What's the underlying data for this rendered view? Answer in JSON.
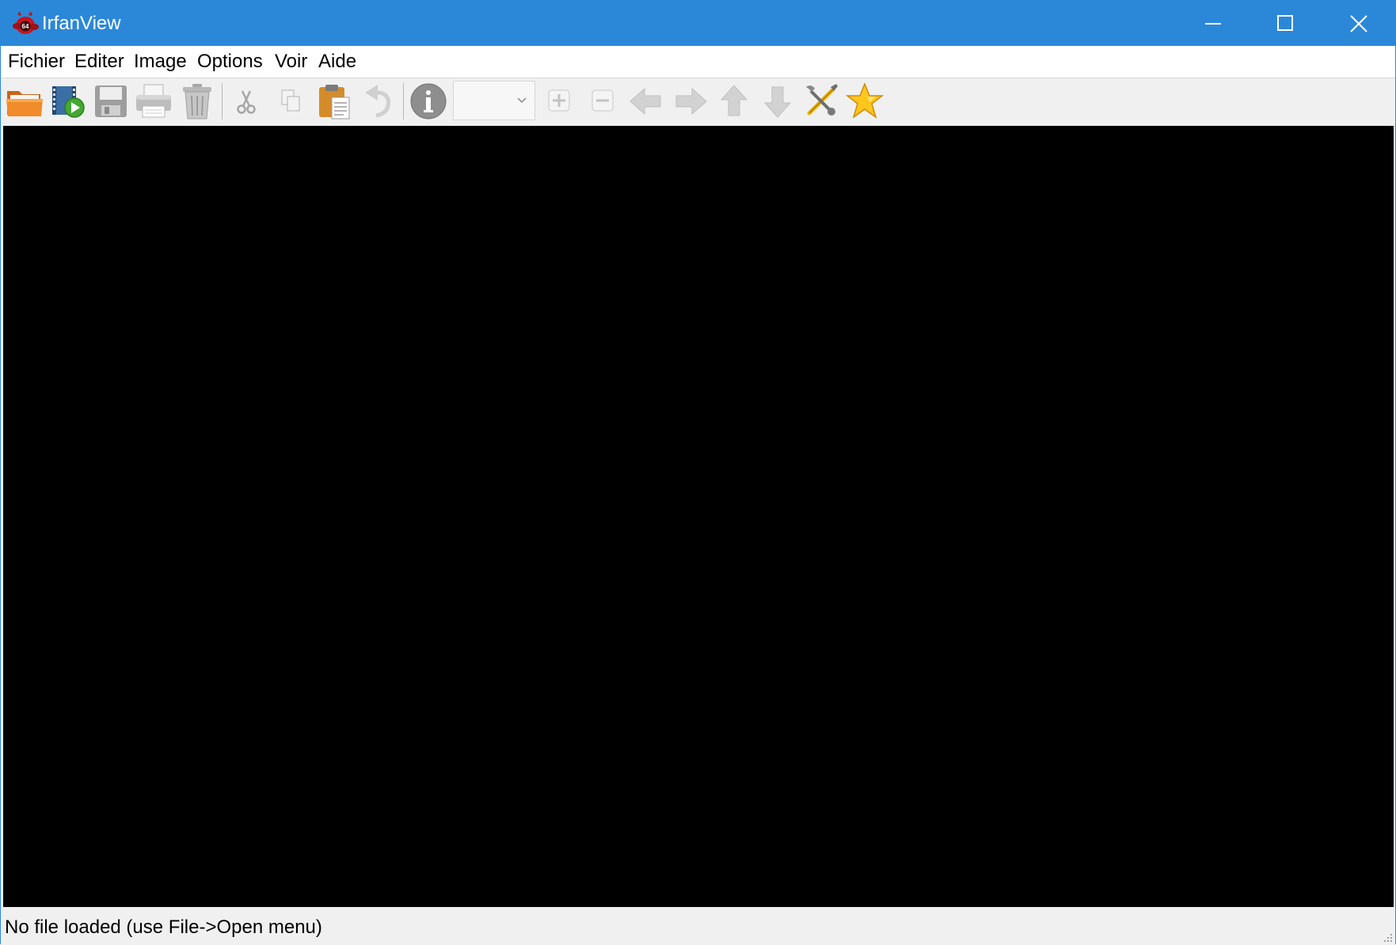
{
  "window": {
    "title": "IrfanView",
    "app_icon": "irfanview-devil-icon",
    "app_icon_badge": "64",
    "controls": [
      "minimize-icon",
      "maximize-icon",
      "close-icon"
    ]
  },
  "colors": {
    "titlebar": "#2b88d8",
    "viewer_background": "#000000",
    "chrome": "#f0f0f0"
  },
  "menu": {
    "items": [
      {
        "label": "Fichier"
      },
      {
        "label": "Editer"
      },
      {
        "label": "Image"
      },
      {
        "label": "Options"
      },
      {
        "label": "Voir"
      },
      {
        "label": "Aide"
      }
    ]
  },
  "toolbar": {
    "buttons": [
      {
        "icon": "open-folder-icon",
        "enabled": true
      },
      {
        "icon": "slideshow-icon",
        "enabled": true
      },
      {
        "icon": "save-icon",
        "enabled": false
      },
      {
        "icon": "print-icon",
        "enabled": false
      },
      {
        "icon": "delete-icon",
        "enabled": false
      },
      {
        "icon": "cut-icon",
        "enabled": false
      },
      {
        "icon": "copy-icon",
        "enabled": false
      },
      {
        "icon": "paste-icon",
        "enabled": true
      },
      {
        "icon": "undo-icon",
        "enabled": false
      },
      {
        "icon": "info-icon",
        "enabled": true
      },
      {
        "icon": "zoom-in-icon",
        "enabled": false
      },
      {
        "icon": "zoom-out-icon",
        "enabled": false
      },
      {
        "icon": "arrow-left-icon",
        "enabled": false
      },
      {
        "icon": "arrow-right-icon",
        "enabled": false
      },
      {
        "icon": "arrow-up-icon",
        "enabled": false
      },
      {
        "icon": "arrow-down-icon",
        "enabled": false
      },
      {
        "icon": "tools-icon",
        "enabled": true
      },
      {
        "icon": "favorite-star-icon",
        "enabled": true
      }
    ],
    "zoom_value": ""
  },
  "status": {
    "text": "No file loaded (use File->Open menu)"
  }
}
